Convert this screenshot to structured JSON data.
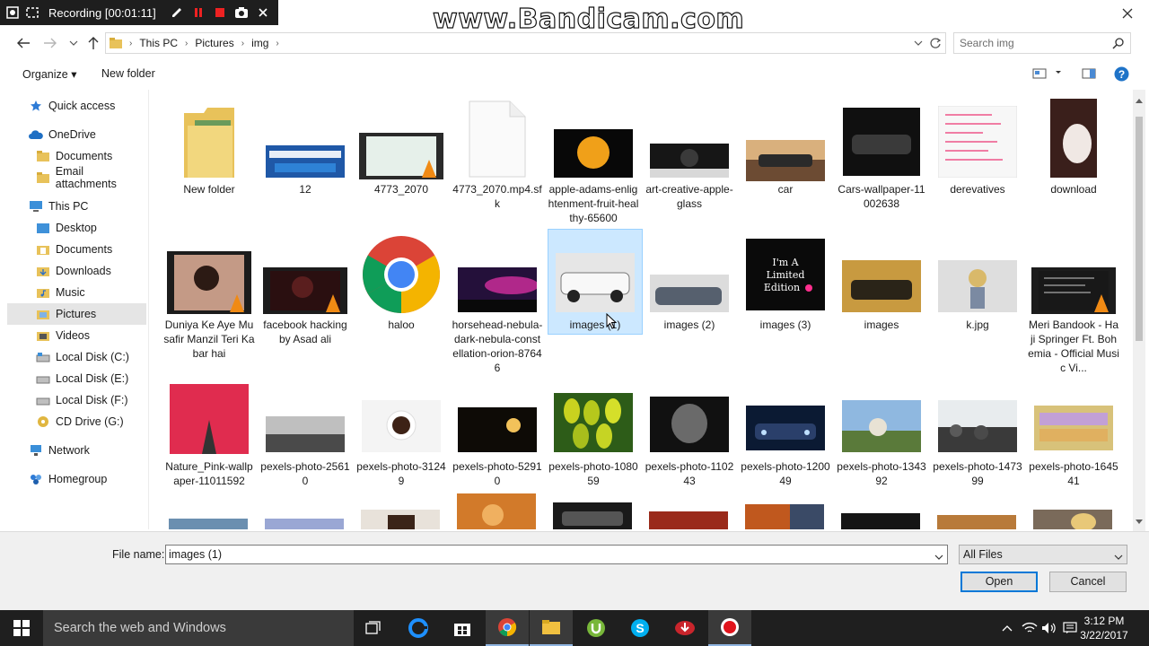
{
  "recording": {
    "text": "Recording [00:01:11]"
  },
  "watermark": "www.Bandicam.com",
  "address": {
    "crumbs": [
      "This PC",
      "Pictures",
      "img"
    ]
  },
  "search": {
    "placeholder": "Search img"
  },
  "toolbar": {
    "organize": "Organize ▾",
    "new_folder": "New folder"
  },
  "nav": {
    "items": [
      {
        "label": "Quick access",
        "icon": "star-icon"
      },
      {
        "label": "OneDrive",
        "icon": "cloud-icon"
      },
      {
        "label": "Documents",
        "icon": "folder-icon"
      },
      {
        "label": "Email attachments",
        "icon": "folder-icon"
      },
      {
        "label": "This PC",
        "icon": "computer-icon"
      },
      {
        "label": "Desktop",
        "icon": "folder-icon"
      },
      {
        "label": "Documents",
        "icon": "folder-icon"
      },
      {
        "label": "Downloads",
        "icon": "folder-icon"
      },
      {
        "label": "Music",
        "icon": "folder-icon"
      },
      {
        "label": "Pictures",
        "icon": "folder-icon"
      },
      {
        "label": "Videos",
        "icon": "folder-icon"
      },
      {
        "label": "Local Disk (C:)",
        "icon": "drive-icon"
      },
      {
        "label": "Local Disk (E:)",
        "icon": "drive-icon"
      },
      {
        "label": "Local Disk (F:)",
        "icon": "drive-icon"
      },
      {
        "label": "CD Drive (G:)",
        "icon": "cd-drive-icon"
      },
      {
        "label": "Network",
        "icon": "network-icon"
      },
      {
        "label": "Homegroup",
        "icon": "homegroup-icon"
      }
    ]
  },
  "files": [
    {
      "label": "New folder"
    },
    {
      "label": "12"
    },
    {
      "label": "4773_2070"
    },
    {
      "label": "4773_2070.mp4.sfk"
    },
    {
      "label": "apple-adams-enlightenment-fruit-healthy-65600"
    },
    {
      "label": "art-creative-apple-glass"
    },
    {
      "label": "car"
    },
    {
      "label": "Cars-wallpaper-11002638"
    },
    {
      "label": "derevatives"
    },
    {
      "label": "download"
    },
    {
      "label": "Duniya Ke Aye Musafir Manzil Teri Kabar hai"
    },
    {
      "label": "facebook hacking by Asad ali"
    },
    {
      "label": "haloo"
    },
    {
      "label": "horsehead-nebula-dark-nebula-constellation-orion-87646"
    },
    {
      "label": "images (1)"
    },
    {
      "label": "images (2)"
    },
    {
      "label": "images (3)"
    },
    {
      "label": "images"
    },
    {
      "label": "k.jpg"
    },
    {
      "label": "Meri Bandook - Haji Springer Ft. Bohemia - Official Music Vi..."
    },
    {
      "label": "Nature_Pink-wallpaper-11011592"
    },
    {
      "label": "pexels-photo-25610"
    },
    {
      "label": "pexels-photo-31249"
    },
    {
      "label": "pexels-photo-52910"
    },
    {
      "label": "pexels-photo-108059"
    },
    {
      "label": "pexels-photo-110243"
    },
    {
      "label": "pexels-photo-120049"
    },
    {
      "label": "pexels-photo-134392"
    },
    {
      "label": "pexels-photo-147399"
    },
    {
      "label": "pexels-photo-164541"
    }
  ],
  "filename": {
    "label": "File name:",
    "value": "images (1)"
  },
  "filetype": {
    "value": "All Files"
  },
  "buttons": {
    "open": "Open",
    "cancel": "Cancel"
  },
  "taskbar": {
    "search": "Search the web and Windows",
    "time": "3:12 PM",
    "date": "3/22/2017"
  },
  "colors": {
    "accent": "#0078d7",
    "selection": "#cce8ff",
    "taskbar": "#1f1f1f"
  }
}
